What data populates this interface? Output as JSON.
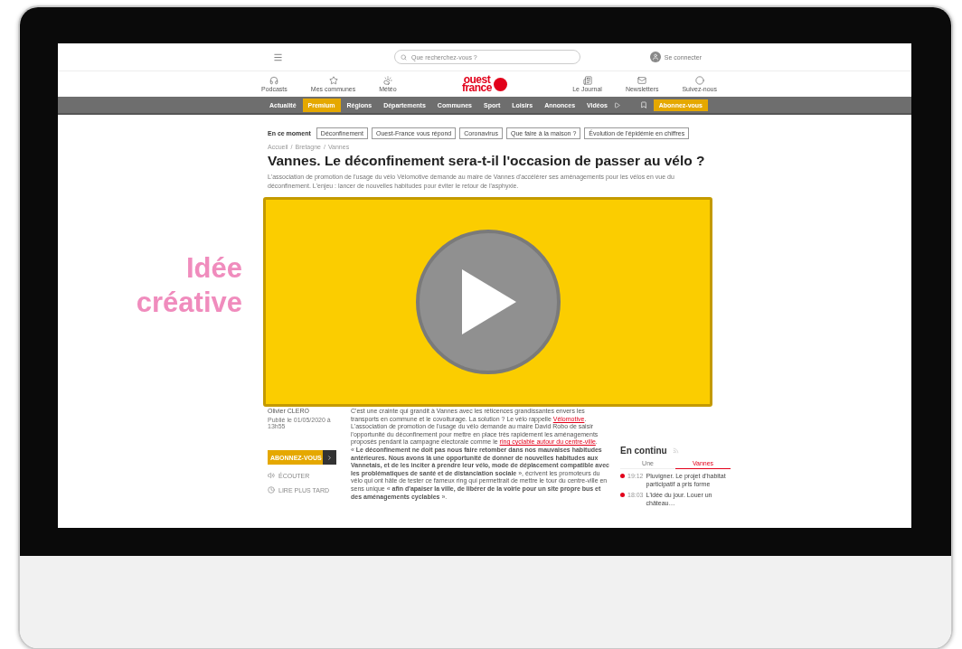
{
  "caption": "Idée créative",
  "header": {
    "search_placeholder": "Que recherchez-vous ?",
    "login": "Se connecter",
    "logo_top": "ouest",
    "logo_bottom": "france"
  },
  "shortcuts_left": [
    {
      "label": "Podcasts",
      "kind": "headphones"
    },
    {
      "label": "Mes communes",
      "kind": "star"
    },
    {
      "label": "Météo",
      "kind": "weather"
    }
  ],
  "shortcuts_right": [
    {
      "label": "Le Journal",
      "kind": "newspaper"
    },
    {
      "label": "Newsletters",
      "kind": "mail"
    },
    {
      "label": "Suivez-nous",
      "kind": "follow"
    }
  ],
  "nav": [
    {
      "label": "Actualité",
      "selected": false
    },
    {
      "label": "Premium",
      "selected": true
    },
    {
      "label": "Régions",
      "selected": false
    },
    {
      "label": "Départements",
      "selected": false
    },
    {
      "label": "Communes",
      "selected": false
    },
    {
      "label": "Sport",
      "selected": false
    },
    {
      "label": "Loisirs",
      "selected": false
    },
    {
      "label": "Annonces",
      "selected": false
    },
    {
      "label": "Vidéos",
      "selected": false
    }
  ],
  "subscribe_nav": "Abonnez-vous",
  "moment": {
    "label": "En ce moment",
    "tags": [
      "Déconfinement",
      "Ouest-France vous répond",
      "Coronavirus",
      "Que faire à la maison ?",
      "Évolution de l'épidémie en chiffres"
    ]
  },
  "breadcrumb": {
    "separator": "/",
    "items": [
      "Accueil",
      "Bretagne",
      "Vannes"
    ]
  },
  "title": "Vannes. Le déconfinement sera-t-il l'occasion de passer au vélo ?",
  "lead": "L'association de promotion de l'usage du vélo Vélomotive demande au maire de Vannes d'accélérer ses aménagements pour les vélos en vue du déconfinement. L'enjeu : lancer de nouvelles habitudes pour éviter le retour de l'asphyxie.",
  "author": {
    "name": "Olivier CLERO",
    "date": "Publié le 01/05/2020 à 13h55",
    "subscribe": "ABONNEZ-VOUS",
    "listen": "ÉCOUTER",
    "read_later": "LIRE PLUS TARD"
  },
  "article": [
    [
      {
        "kind": "text",
        "text": "C'est une crainte qui grandit à Vannes avec les réticences grandissantes envers les transports en commune et le covoiturage. La solution ? Le vélo rappelle "
      },
      {
        "kind": "link",
        "text": "Vélomotive"
      },
      {
        "kind": "text",
        "text": ". L'association de promotion de l'usage du vélo demande au maire David Robo de saisir l'opportunité du déconfinement pour mettre en place très rapidement les aménagements proposés pendant la campagne électorale comme le "
      },
      {
        "kind": "link",
        "text": "ring cyclable autour du centre-ville"
      },
      {
        "kind": "text",
        "text": "."
      }
    ],
    [
      {
        "kind": "text",
        "text": "« **Le déconfinement ne doit pas nous faire retomber dans nos mauvaises habitudes antérieures. Nous avons là une opportunité de donner de nouvelles habitudes aux Vannetais, et de les inciter à prendre leur vélo, mode de déplacement compatible avec les problématiques de santé et de distanciation sociale** », écrivent les promoteurs du vélo qui ont hâte de tester ce fameux ring qui permettrait de mettre le tour du centre-ville en sens unique « **afin d'apaiser la ville, de libérer de la voirie pour un site propre bus et des aménagements cyclables** »."
      }
    ]
  ],
  "live": {
    "title": "En continu",
    "tabs": [
      {
        "label": "Une",
        "selected": false
      },
      {
        "label": "Vannes",
        "selected": true
      }
    ],
    "items": [
      {
        "time": "19:12",
        "text": "Pluvigner. Le projet d'habitat participatif a pris forme"
      },
      {
        "time": "18:03",
        "text": "L'idée du jour. Louer un château…"
      }
    ]
  }
}
